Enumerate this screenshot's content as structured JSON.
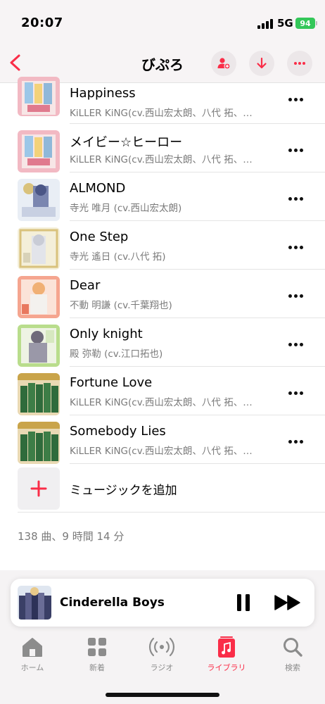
{
  "status": {
    "time": "20:07",
    "network": "5G",
    "battery": "94"
  },
  "nav": {
    "title": "びぷろ"
  },
  "tracks": [
    {
      "title": "Happiness",
      "artist": "KiLLER KiNG(cv.西山宏太朗、八代 拓、…"
    },
    {
      "title": "メイビー☆ヒーロー",
      "artist": "KiLLER KiNG(cv.西山宏太朗、八代 拓、…"
    },
    {
      "title": "ALMOND",
      "artist": "寺光 唯月 (cv.西山宏太朗)"
    },
    {
      "title": "One Step",
      "artist": "寺光 遙日 (cv.八代 拓)"
    },
    {
      "title": "Dear",
      "artist": "不動 明謙 (cv.千葉翔也)"
    },
    {
      "title": "Only knight",
      "artist": "殿 弥勒 (cv.江口拓也)"
    },
    {
      "title": "Fortune Love",
      "artist": "KiLLER KiNG(cv.西山宏太朗、八代 拓、…"
    },
    {
      "title": "Somebody Lies",
      "artist": "KiLLER KiNG(cv.西山宏太朗、八代 拓、…"
    }
  ],
  "add_music": {
    "label": "ミュージックを追加"
  },
  "summary": "138 曲、9 時間 14 分",
  "now_playing": {
    "title": "Cinderella Boys"
  },
  "tabs": [
    {
      "label": "ホーム",
      "icon": "house-icon"
    },
    {
      "label": "新着",
      "icon": "grid-icon"
    },
    {
      "label": "ラジオ",
      "icon": "radio-waves-icon"
    },
    {
      "label": "ライブラリ",
      "icon": "music-note-icon",
      "active": true
    },
    {
      "label": "検索",
      "icon": "search-icon"
    }
  ],
  "colors": {
    "accent": "#fa2d48",
    "battery": "#34c759"
  }
}
